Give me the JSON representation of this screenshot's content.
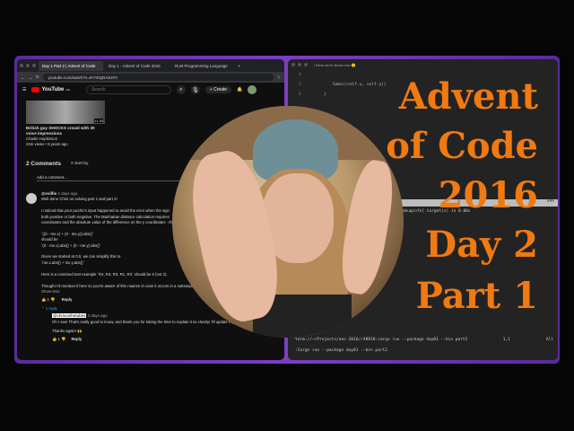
{
  "browser": {
    "tabs": [
      "Day 1 Part 2 | Advent of Code",
      "Day 1 - Advent of Code 2016",
      "Rust Programming Language"
    ],
    "url": "youtube.com/watch?v=87AhQDASxF0",
    "youtube": {
      "logo": "YouTube",
      "country": "GB",
      "search_placeholder": "Search",
      "create": "Create"
    },
    "video": {
      "duration": "11:30",
      "title": "British guy SHOCKS crowd with 30 voice impressions",
      "channel": "Charlie Hopkinson",
      "meta": "22m views • 5 years ago"
    },
    "comments": {
      "count": "2 Comments",
      "sort": "Sort by",
      "add": "Add a comment...",
      "first": {
        "author": "@evilfie",
        "time": "2 days ago",
        "lines": [
          "Well done Chris on solving part 1 and part 2!",
          "",
          "I noticed that your puzzle's input happened to avoid the error when the sign",
          "both positive or both negative. The Manhattan distance calculation requires",
          "coordinates and the absolute value of the difference on the y coordinates - th",
          "",
          "`((0 - me.x) + (0 - me.y)).abs()`",
          "should be",
          "`(0 - me.x).abs() + (0 - me.y).abs()`",
          "",
          "Given we started at 0,0, we can simplify this to",
          "`me.x.abs() + me.y.abs()`",
          "",
          "Here is a contrived test example `R4, R3, R3, R1, R3` should be 6 (not 2).",
          "",
          "Thought I'd mention it here so you're aware of this nuance in case it occurs in a subsequent p"
        ],
        "show_less": "Show less",
        "likes": "1",
        "reply": "Reply"
      },
      "replies_toggle": "1 reply",
      "reply": {
        "author": "@chrisonthetubes",
        "time": "2 days ago",
        "text": "Oh I see! That's really good to know, and thank you for taking the time to explain it so clearly! I'll update my c",
        "thanks": "Thanks again! 🙌",
        "likes": "1",
        "reply": "Reply"
      }
    }
  },
  "terminal": {
    "title": "I think we're alone now 🙂",
    "lines": [
      {
        "n": "4",
        "code": ""
      },
      {
        "n": "5",
        "code": "Some((self.x, self.y))"
      },
      {
        "n": "6",
        "code": "}"
      }
    ],
    "status_pct": "69%",
    "status_pos": "1,1",
    "output": "debuginfo] target(s) in 0.00s",
    "statusline": "term://~/Projects/aoc-2016//48810:cargo run --package day01 --bin part2",
    "pos": "1,1",
    "all": "All",
    "cmd": ":Cargo run --package day01 --bin part2"
  },
  "overlay": [
    "Advent",
    "of Code",
    "2016",
    "Day 2",
    "Part 1"
  ],
  "colors": {
    "accent": "#f07a12",
    "frame": "#7a3fc0"
  }
}
